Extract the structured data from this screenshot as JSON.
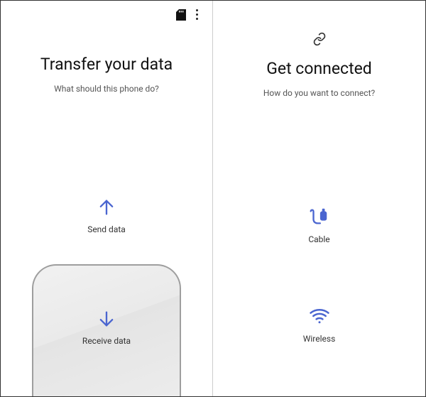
{
  "left": {
    "title": "Transfer your data",
    "subtitle": "What should this phone do?",
    "send_label": "Send data",
    "receive_label": "Receive data"
  },
  "right": {
    "title": "Get connected",
    "subtitle": "How do you want to connect?",
    "cable_label": "Cable",
    "wireless_label": "Wireless"
  },
  "colors": {
    "accent": "#4a65d0"
  }
}
